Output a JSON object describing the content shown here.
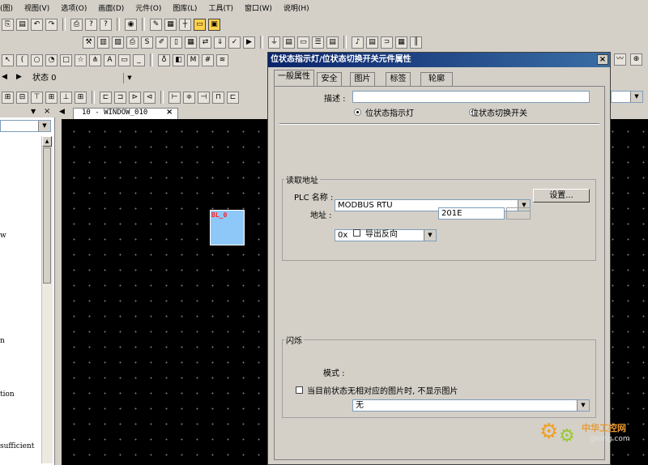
{
  "menu": [
    "(图)",
    "视图(V)",
    "选项(O)",
    "画面(D)",
    "元件(O)",
    "图库(L)",
    "工具(T)",
    "窗口(W)",
    "说明(H)"
  ],
  "toolbar": {
    "state_label": "状态 0"
  },
  "editor_tab": {
    "label": "10 - WINDOW_010",
    "close": "×"
  },
  "left_panel": {
    "close": "×",
    "fragments": [
      "w",
      "n",
      "tion",
      "sufficient"
    ]
  },
  "canvas": {
    "element_label": "BL_0",
    "element_color": "#8ec8f8",
    "label_color": "#ff2020"
  },
  "dialog": {
    "title": "位状态指示灯/位状态切换开关元件属性",
    "close": "×",
    "tabs": [
      "一般属性",
      "安全",
      "图片",
      "标签",
      "轮廓"
    ],
    "desc_label": "描述 :",
    "desc_value": "",
    "radio1": "位状态指示灯",
    "radio2": "位状态切换开关",
    "read_group": "读取地址",
    "plc_label": "PLC 名称 :",
    "plc_value": "MODBUS RTU",
    "settings_btn": "设置...",
    "addr_label": "地址 :",
    "addr_type": "0x",
    "addr_value": "201E",
    "invert_label": "导出反向",
    "blink_group": "闪烁",
    "mode_label": "模式 :",
    "mode_value": "无",
    "hide_label": "当目前状态无相对应的图片时, 不显示图片"
  },
  "watermark": {
    "brand": "中华工控网",
    "url": "gkong.com"
  }
}
